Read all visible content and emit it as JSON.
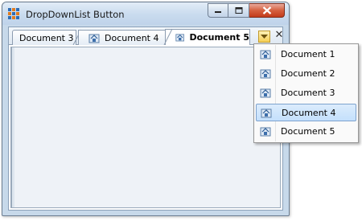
{
  "window": {
    "title": "DropDownList Button"
  },
  "tabs": [
    {
      "label": "Document 3",
      "has_icon": false,
      "active": false
    },
    {
      "label": "Document 4",
      "has_icon": true,
      "active": false
    },
    {
      "label": "Document 5",
      "has_icon": true,
      "active": true
    }
  ],
  "tabstrip": {
    "close_glyph": "✕"
  },
  "dropdown": {
    "items": [
      {
        "label": "Document 1",
        "selected": false
      },
      {
        "label": "Document 2",
        "selected": false
      },
      {
        "label": "Document 3",
        "selected": false
      },
      {
        "label": "Document 4",
        "selected": true
      },
      {
        "label": "Document 5",
        "selected": false
      }
    ]
  },
  "colors": {
    "title_bar": "#c9dbee",
    "close_button": "#d5603f",
    "dropdown_button": "#f6cf54",
    "menu_highlight": "#c4e0fc"
  }
}
